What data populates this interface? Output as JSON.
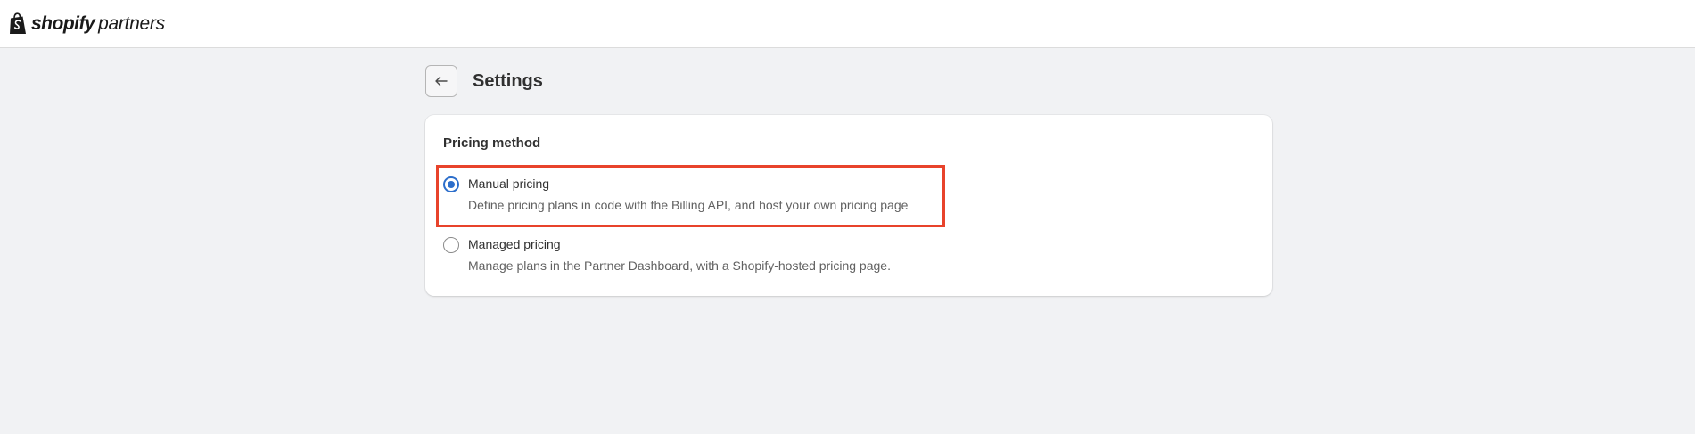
{
  "topbar": {
    "brand_word": "shopify",
    "brand_sub": "partners"
  },
  "header": {
    "title": "Settings"
  },
  "pricing": {
    "section_title": "Pricing method",
    "options": [
      {
        "label": "Manual pricing",
        "help": "Define pricing plans in code with the Billing API, and host your own pricing page",
        "selected": true
      },
      {
        "label": "Managed pricing",
        "help": "Manage plans in the Partner Dashboard, with a Shopify-hosted pricing page.",
        "selected": false
      }
    ]
  },
  "colors": {
    "accent": "#2c6ecb",
    "highlight": "#e8432b",
    "background": "#f1f2f4"
  },
  "icons": {
    "brand": "shopify-bag-icon",
    "back": "arrow-left-icon"
  }
}
